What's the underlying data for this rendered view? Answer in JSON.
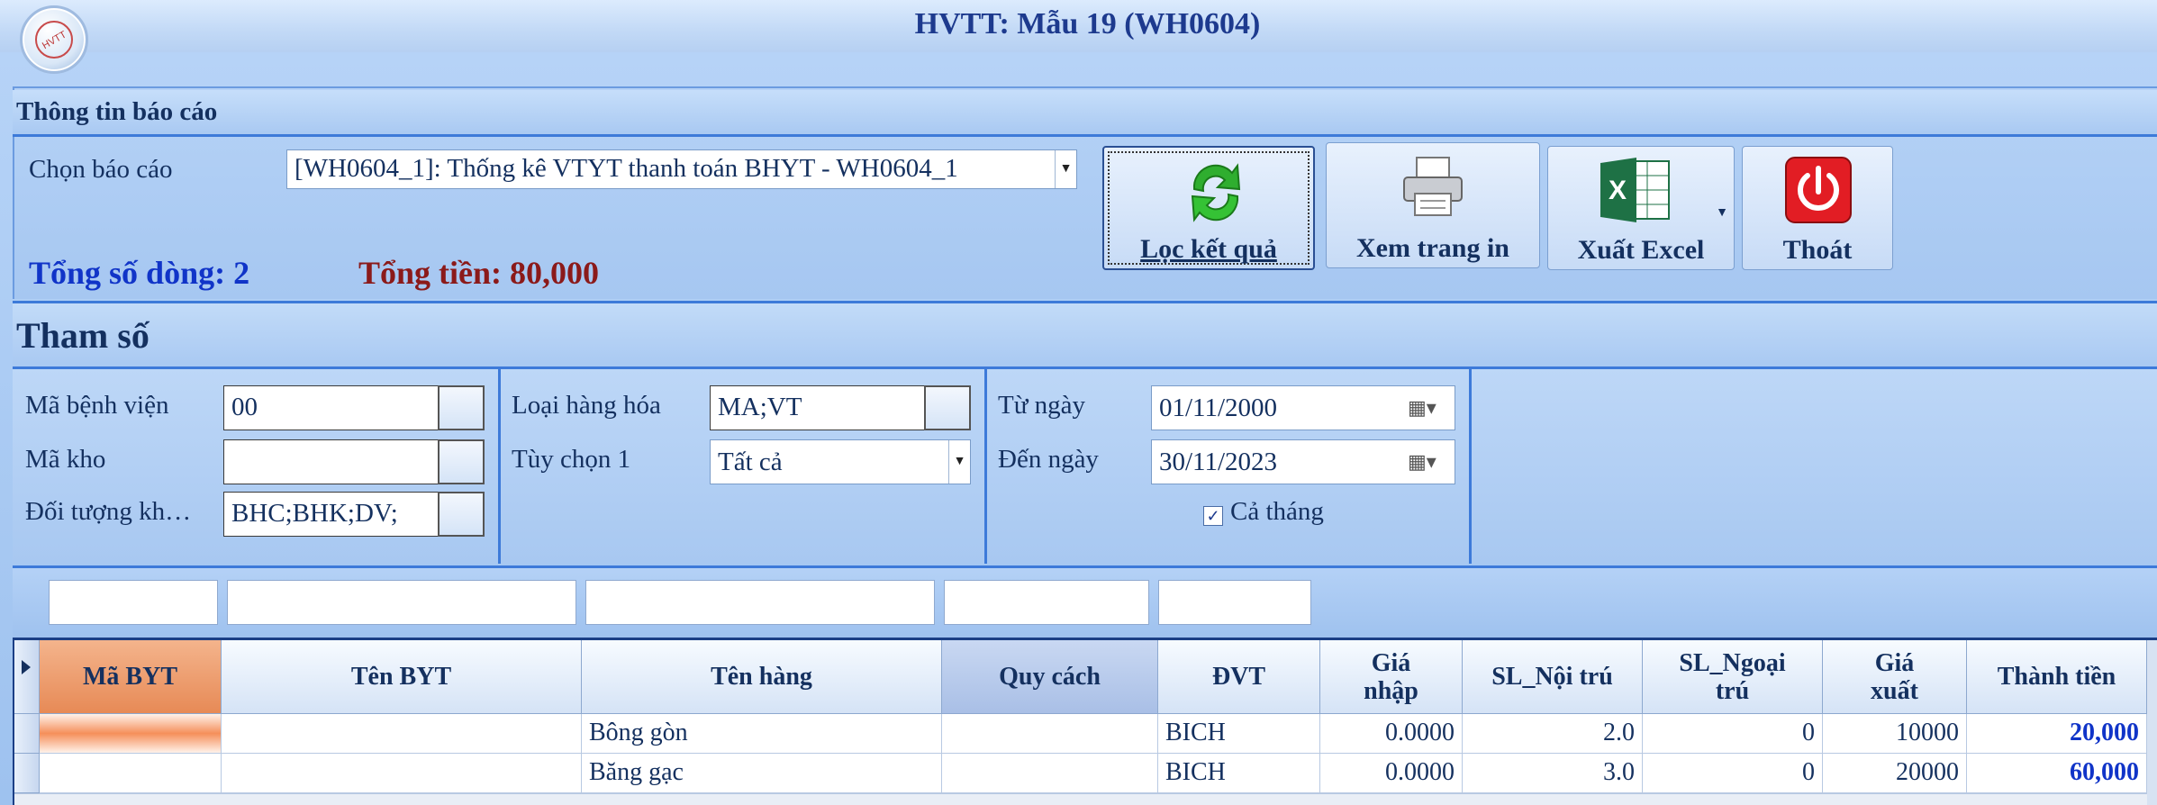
{
  "window": {
    "title": "HVTT: Mẫu 19 (WH0604)",
    "logo_text": "HVTT"
  },
  "report_info": {
    "header": "Thông tin báo cáo",
    "choose_label": "Chọn báo cáo",
    "choose_value": "[WH0604_1]: Thống kê VTYT thanh toán BHYT - WH0604_1",
    "total_rows": "Tổng số dòng: 2",
    "total_money": "Tổng tiền: 80,000"
  },
  "toolbar": {
    "filter": "Lọc kết quả",
    "print": "Xem trang in",
    "excel": "Xuất Excel",
    "exit": "Thoát"
  },
  "params": {
    "header": "Tham số",
    "hospital_label": "Mã bệnh viện",
    "hospital_value": "00",
    "warehouse_label": "Mã kho",
    "warehouse_value": "",
    "patient_label": "Đối tượng kh…",
    "patient_value": "BHC;BHK;DV;",
    "goods_label": "Loại hàng hóa",
    "goods_value": "MA;VT",
    "option_label": "Tùy chọn 1",
    "option_value": "Tất cả",
    "from_label": "Từ ngày",
    "from_value": "01/11/2000",
    "to_label": "Đến ngày",
    "to_value": "30/11/2023",
    "whole_month_label": "Cả tháng",
    "whole_month_checked": true
  },
  "grid": {
    "columns": [
      "Mã BYT",
      "Tên BYT",
      "Tên hàng",
      "Quy cách",
      "ĐVT",
      "Giá nhập",
      "SL_Nội trú",
      "SL_Ngoại trú",
      "Giá xuất",
      "Thành tiền"
    ],
    "rows": [
      [
        "",
        "",
        "Bông gòn",
        "",
        "BICH",
        "0.0000",
        "2.0",
        "0",
        "10000",
        "20,000"
      ],
      [
        "",
        "",
        "Băng gạc",
        "",
        "BICH",
        "0.0000",
        "3.0",
        "0",
        "20000",
        "60,000"
      ]
    ]
  },
  "colors": {
    "accent": "#3d7ad9",
    "total_blue": "#1034c8",
    "total_red": "#8b1a1a",
    "selected_header": "#e78a56"
  }
}
